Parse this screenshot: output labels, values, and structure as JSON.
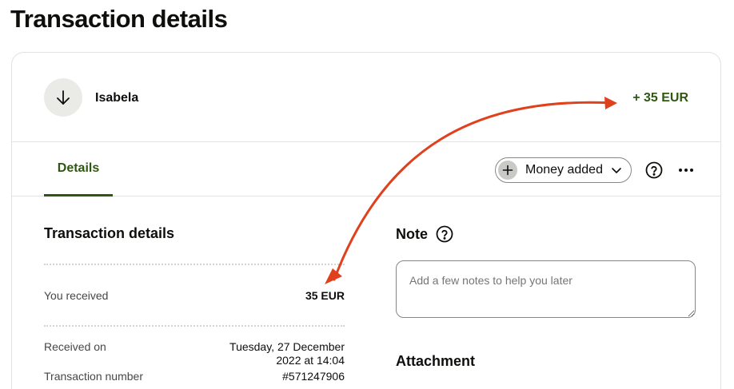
{
  "page": {
    "title": "Transaction details"
  },
  "header": {
    "counterparty": "Isabela",
    "amount": "+ 35 EUR",
    "direction_icon": "arrow-down-icon"
  },
  "tabs": [
    {
      "label": "Details",
      "active": true
    }
  ],
  "toolbar": {
    "category_label": "Money added",
    "category_icon": "plus-icon",
    "help_icon": "question-circle-icon",
    "more_icon": "more-horizontal-icon"
  },
  "details": {
    "title": "Transaction details",
    "rows": [
      {
        "label": "You received",
        "value": "35 EUR"
      },
      {
        "label": "Received on",
        "value": "Tuesday, 27 December 2022 at 14:04"
      },
      {
        "label": "Transaction number",
        "value": "#571247906"
      }
    ]
  },
  "note": {
    "title": "Note",
    "placeholder": "Add a few notes to help you later"
  },
  "attachment": {
    "title": "Attachment"
  },
  "colors": {
    "accent_green": "#2f5711",
    "annotation_arrow": "#e0401c",
    "text_primary": "#0e0f0c",
    "text_secondary": "#454745",
    "border": "#e2e3df"
  }
}
